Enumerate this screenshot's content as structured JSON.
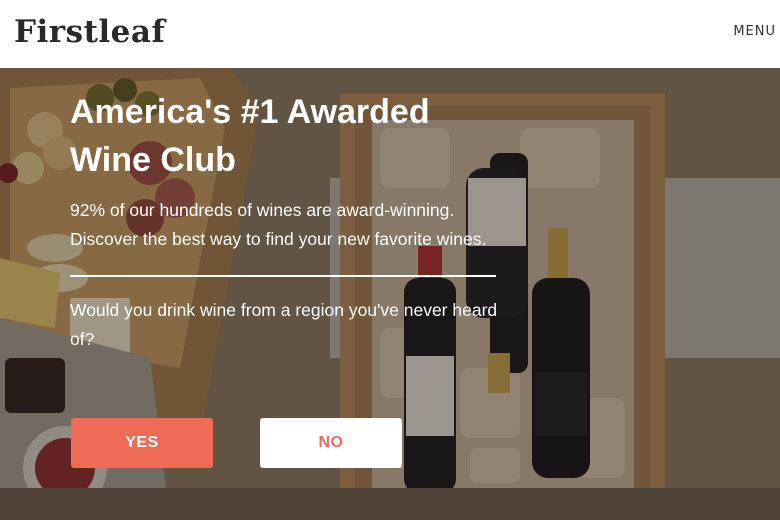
{
  "header": {
    "logo": "Firstleaf",
    "menu_label": "MENU"
  },
  "hero": {
    "headline": "America's #1 Awarded Wine Club",
    "subtext": "92% of our hundreds of wines are award-winning. Discover the best way to find your new favorite wines.",
    "question": "Would you drink wine from a region you've never heard of?",
    "yes_label": "YES",
    "no_label": "NO"
  },
  "colors": {
    "accent": "#ee6b55",
    "text_on_photo": "#ffffff"
  }
}
